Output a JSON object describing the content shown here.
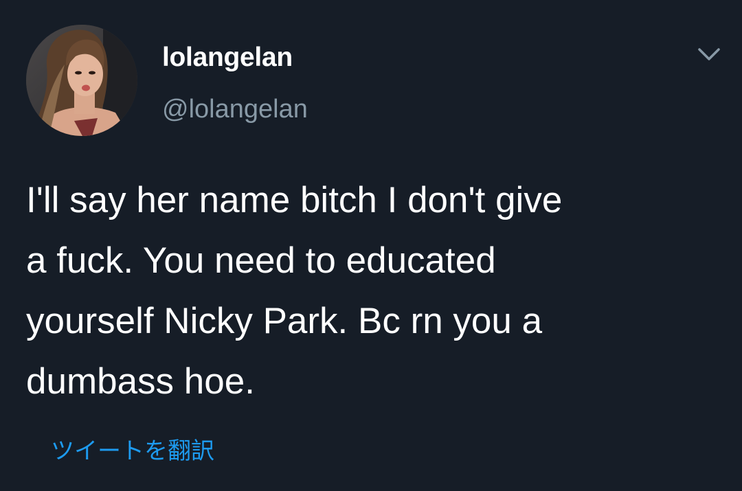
{
  "author": {
    "display_name": "lolangelan",
    "handle": "@lolangelan",
    "avatar_icon": "profile-photo"
  },
  "menu_icon": "chevron-down-icon",
  "tweet": {
    "text": "I'll say her name bitch I don't give\na fuck. You need to educated\nyourself Nicky Park. Bc rn you a\ndumbass hoe."
  },
  "translate": {
    "label": "ツイートを翻訳"
  },
  "colors": {
    "background": "#161d27",
    "primary_text": "#ffffff",
    "secondary_text": "#8899a6",
    "link": "#1d9bf0"
  }
}
